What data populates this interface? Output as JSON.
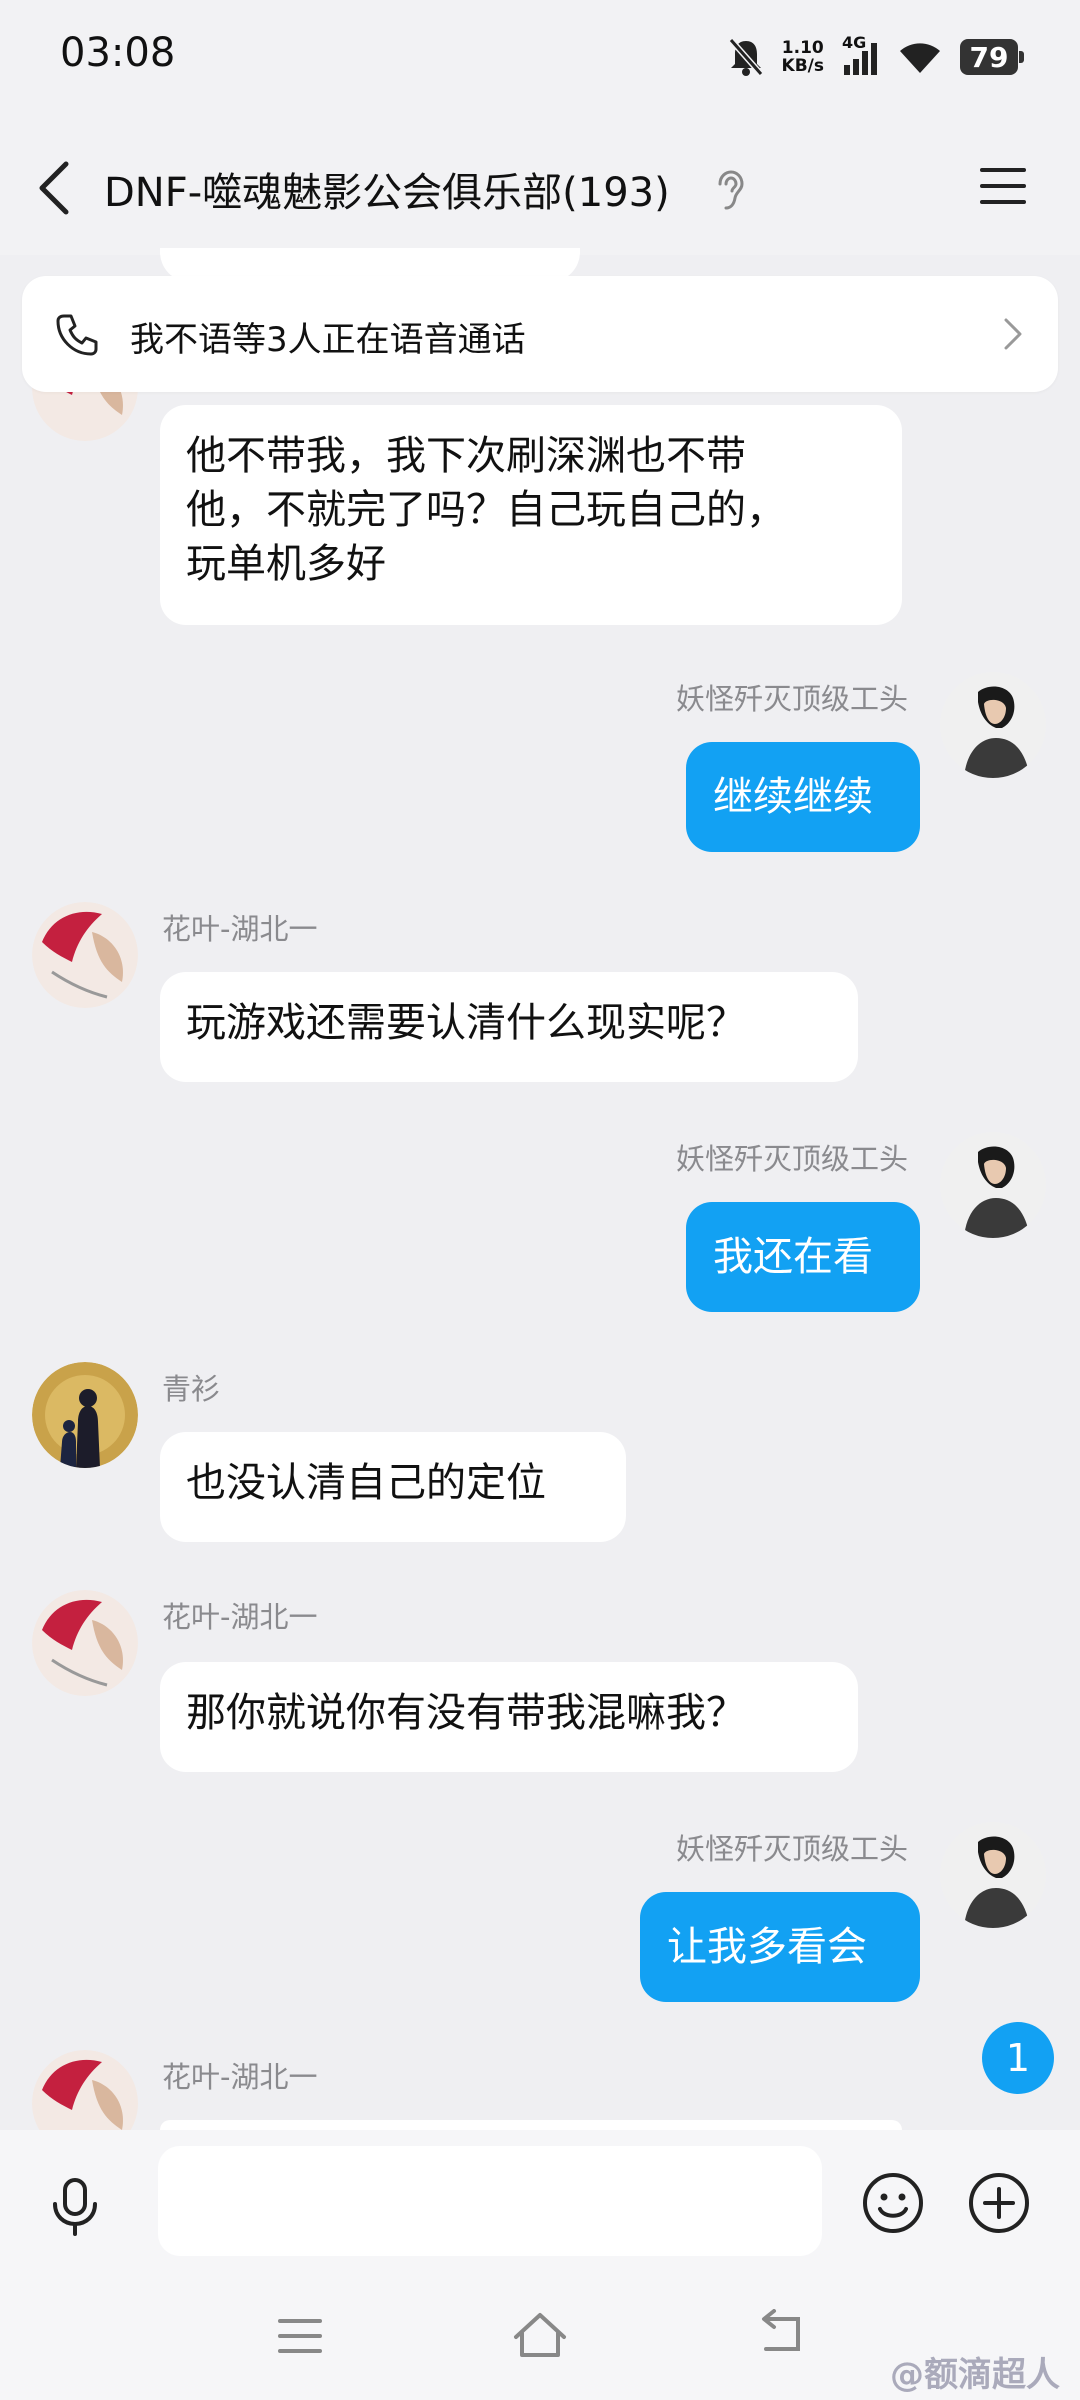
{
  "status": {
    "time": "03:08",
    "net_speed_value": "1.10",
    "net_speed_unit": "KB/s",
    "network": "4G",
    "battery": "79"
  },
  "header": {
    "title": "DNF-噬魂魅影公会俱乐部(193)"
  },
  "voice_banner": {
    "text": "我不语等3人正在语音通话"
  },
  "messages": [
    {
      "sender": "",
      "text_lines": [
        "他不带我，我下次刷深渊也不带",
        "他，不就完了吗？自己玩自己的，",
        "玩单机多好"
      ]
    },
    {
      "sender": "妖怪歼灭顶级工头",
      "text": "继续继续"
    },
    {
      "sender": "花叶-湖北一",
      "text": "玩游戏还需要认清什么现实呢？"
    },
    {
      "sender": "妖怪歼灭顶级工头",
      "text": "我还在看"
    },
    {
      "sender": "青衫",
      "text": "也没认清自己的定位"
    },
    {
      "sender": "花叶-湖北一",
      "text": "那你就说你有没有带我混嘛我？"
    },
    {
      "sender": "妖怪歼灭顶级工头",
      "text": "让我多看会"
    },
    {
      "sender": "花叶-湖北一",
      "text": ""
    }
  ],
  "unread_count": "1",
  "input": {
    "value": "",
    "placeholder": ""
  },
  "watermark": "@额滴超人",
  "colors": {
    "accent": "#12a1f3",
    "background": "#efeff2"
  },
  "icons": [
    "back-icon",
    "ear-icon",
    "menu-icon",
    "phone-icon",
    "chevron-right-icon",
    "mic-icon",
    "emoji-icon",
    "plus-icon"
  ]
}
